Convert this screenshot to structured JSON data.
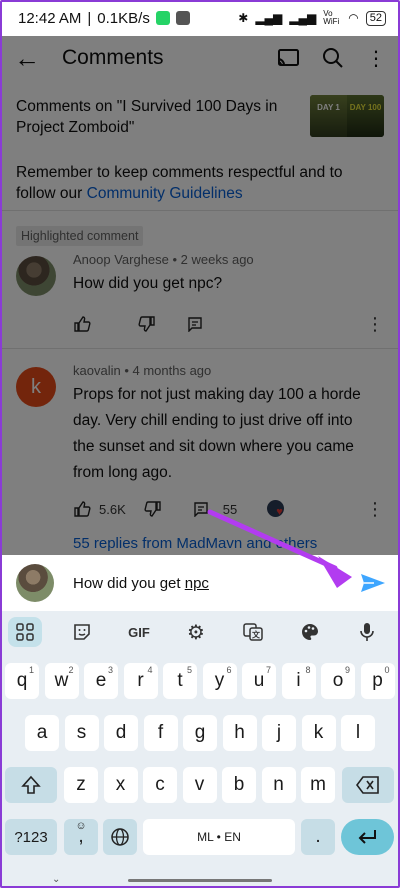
{
  "status": {
    "time": "12:42 AM",
    "speed": "0.1KB/s",
    "battery": "52",
    "volte": "Vo WiFi"
  },
  "appbar": {
    "title": "Comments"
  },
  "video": {
    "line1": "Comments on \"I Survived 100 Days in",
    "line2": "Project Zomboid\"",
    "thumb_left": "DAY 1",
    "thumb_right": "DAY 100"
  },
  "guidelines": {
    "line1": "Remember to keep comments respectful and to",
    "line2_prefix": "follow our ",
    "link": "Community Guidelines"
  },
  "highlighted_label": "Highlighted comment",
  "comments": [
    {
      "author": "Anoop Varghese",
      "age": "2 weeks ago",
      "text": "How did you get npc?"
    },
    {
      "author": "kaovalin",
      "age": "4 months ago",
      "avatar_letter": "k",
      "lines": [
        "Props for not just making day 100 a horde",
        "day. Very chill ending to just drive off into",
        "the sunset and sit down where you came",
        "from long ago."
      ],
      "likes": "5.6K",
      "replies_count": "55"
    }
  ],
  "replies_link": "55 replies from MadMavn and others",
  "input": {
    "text_prefix": "How did you get ",
    "text_underlined": "npc"
  },
  "keyboard": {
    "toolbar": [
      "grid-icon",
      "sticker-icon",
      "GIF",
      "gear-icon",
      "translate-icon",
      "palette-icon",
      "mic-icon"
    ],
    "gif": "GIF",
    "row1": [
      "q",
      "w",
      "e",
      "r",
      "t",
      "y",
      "u",
      "i",
      "o",
      "p"
    ],
    "row1_hints": [
      "1",
      "2",
      "3",
      "4",
      "5",
      "6",
      "7",
      "8",
      "9",
      "0"
    ],
    "row2": [
      "a",
      "s",
      "d",
      "f",
      "g",
      "h",
      "j",
      "k",
      "l"
    ],
    "row3": [
      "z",
      "x",
      "c",
      "v",
      "b",
      "n",
      "m"
    ],
    "symbols": "?123",
    "comma": ",",
    "space": "ML • EN",
    "period": "."
  },
  "colors": {
    "accent": "#065fd4",
    "arrow": "#b23cf0",
    "send": "#3ea6ff",
    "kbd_bg": "#e8eef3"
  }
}
